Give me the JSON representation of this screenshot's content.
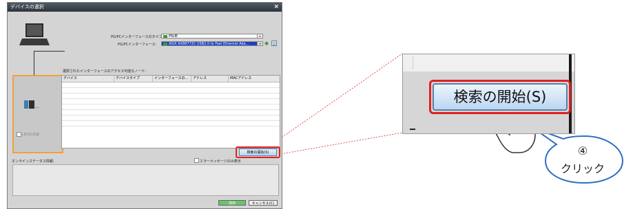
{
  "dialog": {
    "title": "デバイスの選択",
    "close_glyph": "×",
    "pgpc_type_label": "PG/PCインターフェースのタイプ:",
    "pgpc_type_value": "PN/IE",
    "pgpc_if_label": "PG/PCインターフェース:",
    "pgpc_if_value": "ASIX AX88772C USB2.0 to Fast Ethernet Ada...",
    "nodes_label": "選択されたインターフェースのアクセス可能なノード:",
    "led_label": "LEDの点滅",
    "plc_dots": "...",
    "columns": [
      "デバイス",
      "デバイスタイプ",
      "インターフェースの...",
      "アドレス",
      "MACアドレス"
    ],
    "search_button": "検索の開始(S)",
    "online_status_label": "オンラインステータス情報:",
    "error_only_label": "エラーメッセージのみ表示",
    "ok_button": "適用",
    "cancel_button": "キャンセル(C)"
  },
  "zoom": {
    "search_button": "検索の開始(S)"
  },
  "callout": {
    "step_number": "④",
    "action": "クリック"
  },
  "colors": {
    "highlight_red": "#e02020",
    "orange_frame": "#f2a03a",
    "selected_blue": "#1c3fbf"
  }
}
